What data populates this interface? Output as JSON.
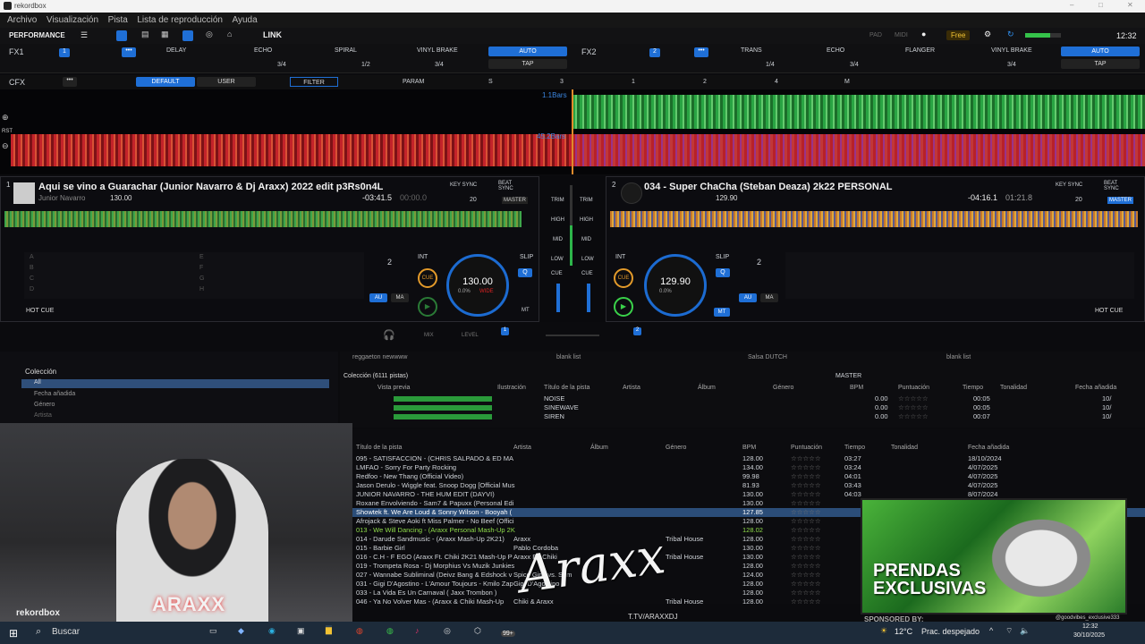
{
  "window": {
    "title": "rekordbox"
  },
  "menu": [
    "Archivo",
    "Visualización",
    "Pista",
    "Lista de reproducción",
    "Ayuda"
  ],
  "toolbar": {
    "mode": "PERFORMANCE",
    "link": "LINK",
    "free": "Free",
    "clock": "12:32",
    "pad": "PAD",
    "midi": "MIDI"
  },
  "fx1": {
    "label": "FX1",
    "effects": [
      "DELAY",
      "ECHO",
      "SPIRAL",
      "VINYL BRAKE"
    ],
    "auto": "AUTO",
    "tap": "TAP",
    "beats": [
      "3/4",
      "1/2",
      "3/4"
    ],
    "nums": [
      "1",
      "2",
      "S",
      "3",
      "4",
      "M"
    ],
    "val1": "1"
  },
  "fx2": {
    "label": "FX2",
    "effects": [
      "TRANS",
      "ECHO",
      "FLANGER",
      "VINYL BRAKE"
    ],
    "auto": "AUTO",
    "tap": "TAP",
    "beats": [
      "1/4",
      "3/4",
      "3/4"
    ],
    "val1": "1"
  },
  "cfx": {
    "label": "CFX",
    "default": "DEFAULT",
    "user": "USER",
    "filter": "FILTER",
    "param": "PARAM",
    "s": "S",
    "n1": "3",
    "n2": "1",
    "n3": "2",
    "n4": "4",
    "m": "M"
  },
  "waveform": {
    "bars1": "1.1Bars",
    "bars2": "45.2Bars",
    "rst": "RST"
  },
  "deck1": {
    "num": "1",
    "title": "Aqui se vino a Guarachar (Junior Navarro & Dj Araxx) 2022 edit p3Rs0n4L",
    "artist": "Junior Navarro",
    "bpm": "130.00",
    "remaining": "-03:41.5",
    "elapsed": "00:00.0",
    "key_sync": "KEY SYNC",
    "beat_sync": "BEAT SYNC",
    "master": "MASTER",
    "key_val": "20",
    "jog_bpm": "130.00",
    "jog_sub": "0.0%",
    "wide": "WIDE",
    "int": "INT",
    "beat": "2",
    "cue": "CUE",
    "slip": "SLIP",
    "q": "Q",
    "au": "AU",
    "ma": "MA",
    "mt": "MT",
    "hotcue": "HOT CUE",
    "pads": [
      "A",
      "B",
      "C",
      "D"
    ],
    "pads2": [
      "E",
      "F",
      "G",
      "H"
    ]
  },
  "deck2": {
    "num": "2",
    "title": "034 - Super ChaCha (Steban Deaza) 2k22 PERSONAL",
    "bpm": "129.90",
    "remaining": "-04:16.1",
    "elapsed": "01:21.8",
    "key_sync": "KEY SYNC",
    "beat_sync": "BEAT SYNC",
    "master": "MASTER",
    "key_val": "20",
    "jog_bpm": "129.90",
    "jog_sub": "0.0%",
    "int": "INT",
    "beat": "2",
    "cue": "CUE",
    "slip": "SLIP",
    "q": "Q",
    "au": "AU",
    "ma": "MA",
    "mt": "MT",
    "hotcue": "HOT CUE"
  },
  "mixer": {
    "trim": "TRIM",
    "high": "HIGH",
    "mid": "MID",
    "low": "LOW",
    "cue": "CUE",
    "mix": "MIX",
    "level": "LEVEL",
    "n1": "1",
    "n2": "2",
    "n3": "3",
    "n4": "4"
  },
  "browser": {
    "tabs": [
      "reggaeton newwww",
      "blank list",
      "Salsa DUTCH",
      "blank list"
    ],
    "collection": "Colección (6111 pistas)",
    "master": "MASTER",
    "columns": [
      "Vista previa",
      "Ilustración",
      "Título de la pista",
      "Artista",
      "Álbum",
      "Género",
      "BPM",
      "Puntuación",
      "Tiempo",
      "Tonalidad",
      "Fecha añadida"
    ],
    "rows": [
      {
        "title": "NOISE",
        "bpm": "0.00",
        "time": "00:05",
        "date": "10/"
      },
      {
        "title": "SINEWAVE",
        "bpm": "0.00",
        "time": "00:05",
        "date": "10/"
      },
      {
        "title": "SIREN",
        "bpm": "0.00",
        "time": "00:07",
        "date": "10/"
      }
    ]
  },
  "tree": {
    "header": "Colección",
    "items": [
      "All",
      "Fecha añadida",
      "Género",
      "Artista"
    ]
  },
  "tracklist": {
    "columns": [
      "Título de la pista",
      "Artista",
      "Álbum",
      "Género",
      "BPM",
      "Puntuación",
      "Tiempo",
      "Tonalidad",
      "Fecha añadida"
    ],
    "rows": [
      {
        "t": "095 - SATISFACCION - (CHRIS SALPADO & ED MA",
        "a": "",
        "g": "",
        "b": "128.00",
        "tm": "03:27",
        "d": "18/10/2024"
      },
      {
        "t": "LMFAO - Sorry For Party Rocking",
        "a": "",
        "g": "",
        "b": "134.00",
        "tm": "03:24",
        "d": "4/07/2025"
      },
      {
        "t": "Redfoo - New Thang (Official Video)",
        "a": "",
        "g": "",
        "b": "99.98",
        "tm": "04:01",
        "d": "4/07/2025"
      },
      {
        "t": "Jason Derulo - Wiggle feat. Snoop Dogg [Official Mus",
        "a": "",
        "g": "",
        "b": "81.93",
        "tm": "03:43",
        "d": "4/07/2025"
      },
      {
        "t": "JUNIOR NAVARRO - THE HUM EDIT (DAYVI)",
        "a": "",
        "g": "",
        "b": "130.00",
        "tm": "04:03",
        "d": "8/07/2024"
      },
      {
        "t": "Roxane Envolviendo - Sam7 & Papuxx (Personal Edi",
        "a": "",
        "g": "",
        "b": "130.00",
        "tm": "",
        "d": ""
      },
      {
        "t": "Showtek ft. We Are Loud & Sonny Wilson - Booyah (",
        "a": "",
        "g": "",
        "b": "127.85",
        "tm": "",
        "d": ""
      },
      {
        "t": "Afrojack & Steve Aoki ft Miss Palmer - No Beef (Offici",
        "a": "",
        "g": "",
        "b": "128.00",
        "tm": "",
        "d": ""
      },
      {
        "t": "013 - We Will Dancing - (Araxx Personal Mash-Up 2K",
        "a": "",
        "g": "",
        "b": "128.02",
        "tm": "",
        "d": ""
      },
      {
        "t": "014 - Darude Sandmusic - (Araxx Mash-Up 2K21)",
        "a": "Araxx",
        "g": "Tribal House",
        "b": "128.00",
        "tm": "",
        "d": ""
      },
      {
        "t": "015 - Barbie Girl",
        "a": "Pablo Cordoba",
        "g": "",
        "b": "130.00",
        "tm": "",
        "d": ""
      },
      {
        "t": "016 - C.H - F EGO (Araxx Ft. Chiki 2K21 Mash-Up P",
        "a": "Araxx Ft. Chiki",
        "g": "Tribal House",
        "b": "130.00",
        "tm": "",
        "d": ""
      },
      {
        "t": "019 - Trompeta Rosa - Dj Morphius Vs Muzik Junkies",
        "a": "",
        "g": "",
        "b": "128.00",
        "tm": "",
        "d": ""
      },
      {
        "t": "027 - Wannabe Subliminal (Deivz Bang & Edshock v",
        "a": "Spice Girls vs. Sum",
        "g": "",
        "b": "124.00",
        "tm": "",
        "d": ""
      },
      {
        "t": "031 - Gigi D'Agostino - L'Amour Toujours - Kmilo Zap",
        "a": "Gigi D'Agostino",
        "g": "",
        "b": "128.00",
        "tm": "",
        "d": ""
      },
      {
        "t": "033 - La Vida Es Un Carnaval ( Jaxx Trombon )",
        "a": "",
        "g": "",
        "b": "128.00",
        "tm": "",
        "d": ""
      },
      {
        "t": "046 - Ya No Volver Mas - (Araxx & Chiki Mash-Up",
        "a": "Chiki & Araxx",
        "g": "Tribal House",
        "b": "128.00",
        "tm": "",
        "d": ""
      }
    ]
  },
  "overlay": {
    "brand": "ARAXX",
    "signature": "Araxx",
    "ttv": "T.TV/ARAXXDJ",
    "promo_line1": "PRENDAS",
    "promo_line2": "EXCLUSIVAS",
    "sponsored": "SPONSORED BY:",
    "logo_text": "rekordbox",
    "handle": "@goodvibes_exclusive333"
  },
  "taskbar": {
    "search": "Buscar",
    "temp": "12°C",
    "weather": "Prac. despejado",
    "time": "12:32",
    "date": "30/10/2025",
    "badge": "99+"
  }
}
